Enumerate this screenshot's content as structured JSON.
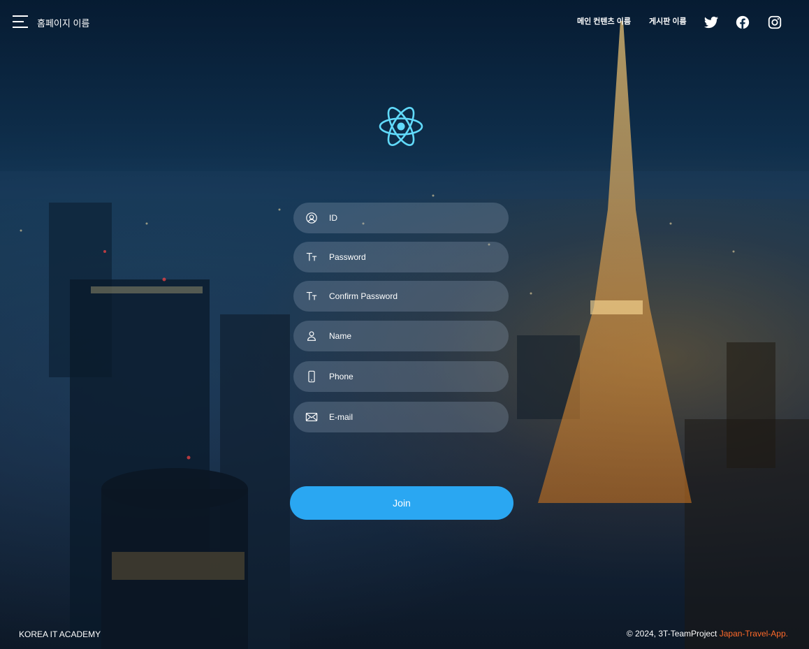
{
  "header": {
    "brand": "홈페이지 이름",
    "nav": [
      "메인 컨텐츠 이름",
      "게시판 이름"
    ],
    "social": [
      "twitter-icon",
      "facebook-icon",
      "instagram-icon"
    ]
  },
  "logo": {
    "icon": "react-atom-icon",
    "color": "#61dafb"
  },
  "form": {
    "fields": [
      {
        "label": "ID",
        "icon": "user-circle-icon"
      },
      {
        "label": "Password",
        "icon": "text-format-icon"
      },
      {
        "label": "Confirm Password",
        "icon": "text-format-icon"
      },
      {
        "label": "Name",
        "icon": "person-icon"
      },
      {
        "label": "Phone",
        "icon": "phone-icon"
      },
      {
        "label": "E-mail",
        "icon": "mail-icon"
      }
    ],
    "submit_label": "Join"
  },
  "footer": {
    "left": "KOREA IT ACADEMY",
    "right_prefix": "© 2024, 3T-TeamProject ",
    "right_accent": "Japan-Travel-App."
  },
  "colors": {
    "button": "#2aa7f2",
    "accent": "#ff6a2a",
    "logo": "#61dafb"
  }
}
